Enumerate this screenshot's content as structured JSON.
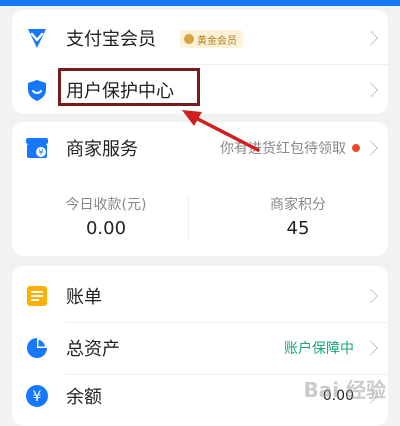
{
  "rows_top": [
    {
      "label": "支付宝会员",
      "badge": "黄金会员"
    },
    {
      "label": "用户保护中心"
    }
  ],
  "merchant": {
    "label": "商家服务",
    "notice": "你有进货红包待领取",
    "stats": [
      {
        "label": "今日收款(元)",
        "value": "0.00"
      },
      {
        "label": "商家积分",
        "value": "45"
      }
    ]
  },
  "rows_bottom": [
    {
      "label": "账单"
    },
    {
      "label": "总资产",
      "right": "账户保障中"
    },
    {
      "label": "余额",
      "right": "0.00"
    }
  ],
  "watermark": "Bai 经验",
  "colors": {
    "brand_blue": "#1677ff",
    "green": "#1aa67a",
    "orange": "#ffb000",
    "highlight": "#7a1a1a",
    "arrow": "#d11f1f"
  }
}
